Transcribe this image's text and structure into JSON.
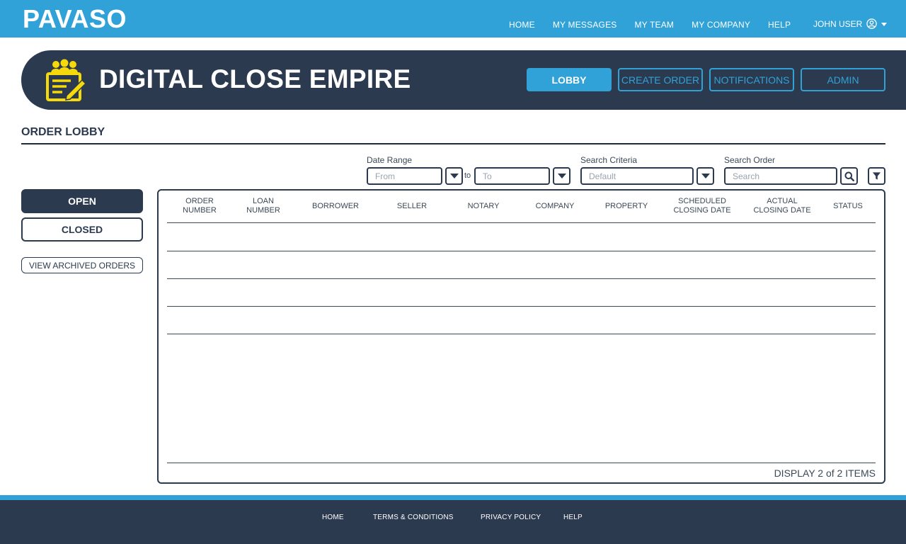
{
  "brand": "PAVASO",
  "topnav": {
    "items": [
      "HOME",
      "MY MESSAGES",
      "MY TEAM",
      "MY COMPANY",
      "HELP"
    ],
    "user_name": "JOHN USER"
  },
  "hero": {
    "title": "DIGITAL CLOSE EMPIRE",
    "buttons": [
      "LOBBY",
      "CREATE ORDER",
      "NOTIFICATIONS",
      "ADMIN"
    ],
    "active_button": "LOBBY"
  },
  "page_title": "ORDER LOBBY",
  "filters": {
    "date_range_label": "Date Range",
    "from_placeholder": "From",
    "to_text": "to",
    "to_placeholder": "To",
    "criteria_label": "Search Criteria",
    "criteria_value": "Default",
    "search_label": "Search Order",
    "search_placeholder": "Search"
  },
  "sidebar": {
    "open_label": "OPEN",
    "closed_label": "CLOSED",
    "archived_label": "VIEW ARCHIVED ORDERS"
  },
  "table": {
    "columns": [
      [
        "ORDER",
        "NUMBER"
      ],
      [
        "LOAN",
        "NUMBER"
      ],
      [
        "BORROWER"
      ],
      [
        "SELLER"
      ],
      [
        "NOTARY"
      ],
      [
        "COMPANY"
      ],
      [
        "PROPERTY"
      ],
      [
        "SCHEDULED",
        "CLOSING DATE"
      ],
      [
        "ACTUAL",
        "CLOSING DATE"
      ],
      [
        "STATUS"
      ]
    ],
    "rows": [
      [],
      [],
      [],
      []
    ],
    "display_text": "DISPLAY 2 of 2 ITEMS"
  },
  "footer": {
    "links": [
      "HOME",
      "TERMS & CONDITIONS",
      "PRIVACY POLICY",
      "HELP"
    ]
  },
  "colors": {
    "accent": "#31a2d8",
    "navy": "#2b3a4e",
    "logo_yellow": "#f5d90a"
  }
}
